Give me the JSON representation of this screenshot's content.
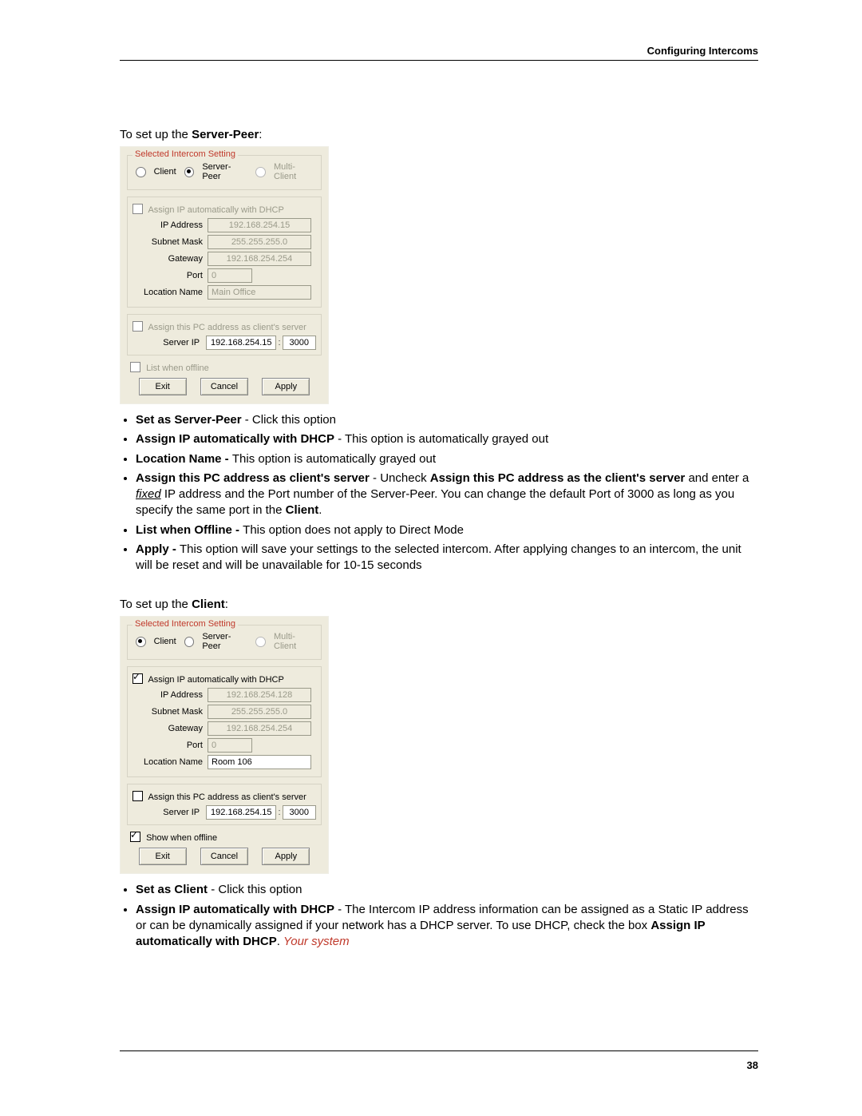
{
  "header": {
    "title": "Configuring Intercoms"
  },
  "footer": {
    "page_number": "38"
  },
  "lead_server_prefix": "To set up the ",
  "lead_server_bold": "Server-Peer",
  "lead_server_suffix": ":",
  "lead_client_prefix": "To set up the ",
  "lead_client_bold": "Client",
  "lead_client_suffix": ":",
  "panel_legend": "Selected Intercom Setting",
  "modes": {
    "client": "Client",
    "server_peer": "Server-Peer",
    "multi_client": "Multi-Client"
  },
  "labels": {
    "assign_dhcp": "Assign IP automatically with  DHCP",
    "ip_address": "IP Address",
    "subnet_mask": "Subnet Mask",
    "gateway": "Gateway",
    "port": "Port",
    "location_name": "Location Name",
    "assign_pc_server": "Assign this PC address as client's server",
    "server_ip": "Server IP",
    "list_when_offline": "List when offline",
    "show_when_offline": "Show when offline",
    "exit": "Exit",
    "cancel": "Cancel",
    "apply": "Apply",
    "colon": ":"
  },
  "server_panel": {
    "ip": "192.168.254.15",
    "subnet": "255.255.255.0",
    "gateway": "192.168.254.254",
    "port": "0",
    "location": "Main Office",
    "server_ip": "192.168.254.15",
    "server_port": "3000"
  },
  "client_panel": {
    "ip": "192.168.254.128",
    "subnet": "255.255.255.0",
    "gateway": "192.168.254.254",
    "port": "0",
    "location": "Room 106",
    "server_ip": "192.168.254.15",
    "server_port": "3000"
  },
  "bullets_server": {
    "b1_bold": "Set as Server-Peer",
    "b1_text": " - Click this option",
    "b2_bold": "Assign IP automatically with DHCP",
    "b2_text": " - This option is automatically grayed out",
    "b3_bold": "Location Name - ",
    "b3_text": "This option is automatically grayed out",
    "b4_bold_a": "Assign this PC address as client's server",
    "b4_mid_a": " - Uncheck ",
    "b4_bold_b": "Assign this PC address as the client's server",
    "b4_mid_b": " and enter a ",
    "b4_fixed": "fixed",
    "b4_mid_c": " IP address and the Port number of the Server-Peer.  You can change the default Port of 3000 as long as you specify the same port in the ",
    "b4_bold_c": "Client",
    "b4_end": ".",
    "b5_bold": "List when Offline - ",
    "b5_text": "This option does not apply to Direct Mode",
    "b6_bold": "Apply - ",
    "b6_text": "This option will save your settings to the selected intercom.  After applying changes to an intercom, the unit will be reset and will be unavailable for 10-15 seconds"
  },
  "bullets_client": {
    "b1_bold": "Set as Client",
    "b1_text": " - Click this option",
    "b2_bold": "Assign IP automatically with DHCP",
    "b2_text_a": " - The Intercom IP address information can be assigned as a Static IP address or can be dynamically assigned if your network has a DHCP server. To use DHCP, check the box ",
    "b2_bold_b": "Assign IP automatically with DHCP",
    "b2_text_b": ". ",
    "b2_red": "Your system"
  }
}
